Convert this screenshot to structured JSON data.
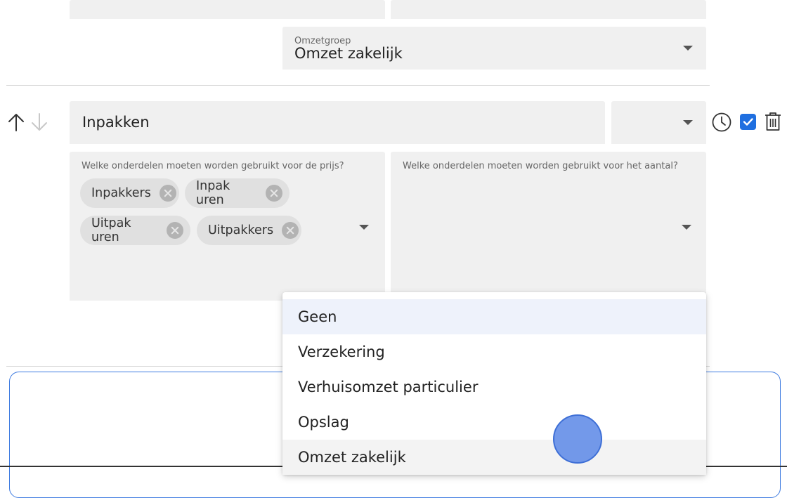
{
  "top_row": {
    "omzetgroep_label": "Omzetgroep",
    "omzetgroep_value": "Omzet zakelijk"
  },
  "item": {
    "name_value": "Inpakken",
    "type_value": "",
    "checkbox_checked": true,
    "price_parts_label": "Welke onderdelen moeten worden gebruikt voor de prijs?",
    "price_parts_chips": [
      "Inpakkers",
      "Inpak uren",
      "Uitpak uren",
      "Uitpakkers"
    ],
    "quantity_parts_label": "Welke onderdelen moeten worden gebruikt voor het aantal?"
  },
  "dropdown": {
    "options": [
      "Geen",
      "Verzekering",
      "Verhuisomzet particulier",
      "Opslag",
      "Omzet zakelijk"
    ],
    "highlighted_index": 0,
    "hovered_index": 4
  },
  "icons": {
    "move_up": "arrow-up-icon",
    "move_down": "arrow-down-icon",
    "schedule": "clock-icon",
    "delete": "trash-icon"
  },
  "colors": {
    "field_background": "#f0f0f0",
    "chip_background": "#e0e0e0",
    "checkbox_accent": "#1f6fe0",
    "highlight_option": "#eef2fb",
    "touch_indicator": "#6f96e8"
  }
}
